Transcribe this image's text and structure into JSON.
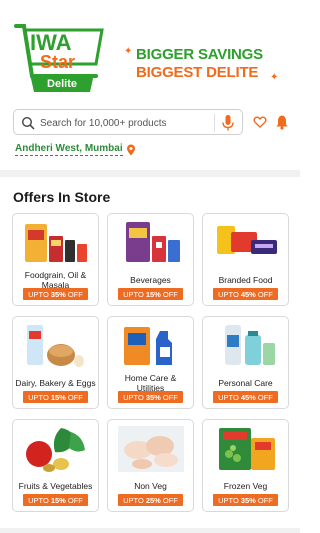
{
  "brand": {
    "logo_word": "Star",
    "logo_sub": "Delite",
    "tagline_line1": "BIGGER SAVINGS",
    "tagline_line2": "BIGGEST DELITE"
  },
  "colors": {
    "brand_green": "#2ea02e",
    "brand_orange": "#f26a1b",
    "badge_orange": "#ee6b22",
    "location_green": "#2d8a3a"
  },
  "search": {
    "placeholder": "Search for 10,000+ products",
    "icons": [
      "search-icon",
      "mic-icon",
      "heart-icon",
      "bell-icon"
    ]
  },
  "location": {
    "text": "Andheri West, Mumbai",
    "icon": "map-pin-icon"
  },
  "offers": {
    "title": "Offers In Store",
    "items": [
      {
        "label": "Foodgrain, Oil & Masala",
        "upto": "UPTO",
        "discount": "35%",
        "suffix": "OFF"
      },
      {
        "label": "Beverages",
        "upto": "UPTO",
        "discount": "15%",
        "suffix": "OFF"
      },
      {
        "label": "Branded Food",
        "upto": "UPTO",
        "discount": "45%",
        "suffix": "OFF"
      },
      {
        "label": "Dairy, Bakery & Eggs",
        "upto": "UPTO",
        "discount": "15%",
        "suffix": "OFF"
      },
      {
        "label": "Home Care & Utilities",
        "upto": "UPTO",
        "discount": "35%",
        "suffix": "OFF"
      },
      {
        "label": "Personal Care",
        "upto": "UPTO",
        "discount": "45%",
        "suffix": "OFF"
      },
      {
        "label": "Fruits & Vegetables",
        "upto": "UPTO",
        "discount": "15%",
        "suffix": "OFF"
      },
      {
        "label": "Non Veg",
        "upto": "UPTO",
        "discount": "25%",
        "suffix": "OFF"
      },
      {
        "label": "Frozen Veg",
        "upto": "UPTO",
        "discount": "35%",
        "suffix": "OFF"
      }
    ]
  }
}
